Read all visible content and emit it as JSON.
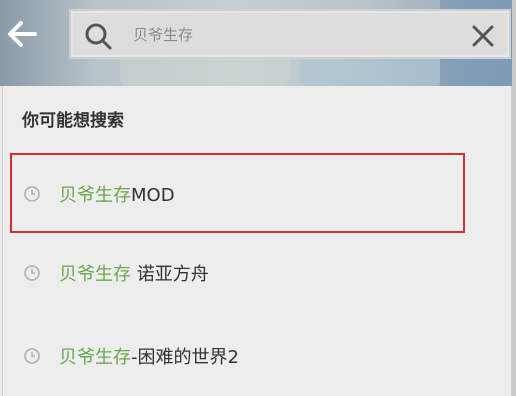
{
  "search": {
    "placeholder": "贝爷生存",
    "value": ""
  },
  "panel": {
    "title": "你可能想搜索"
  },
  "suggestions": [
    {
      "highlight": "贝爷生存",
      "rest": "MOD"
    },
    {
      "highlight": "贝爷生存",
      "rest": " 诺亚方舟"
    },
    {
      "highlight": "贝爷生存",
      "rest": "-困难的世界2"
    }
  ],
  "colors": {
    "highlight_text": "#6aa84f",
    "selection_border": "#d32f2f"
  },
  "icons": {
    "back": "arrow-left-icon",
    "search": "search-icon",
    "clear": "close-icon",
    "history": "clock-icon"
  }
}
